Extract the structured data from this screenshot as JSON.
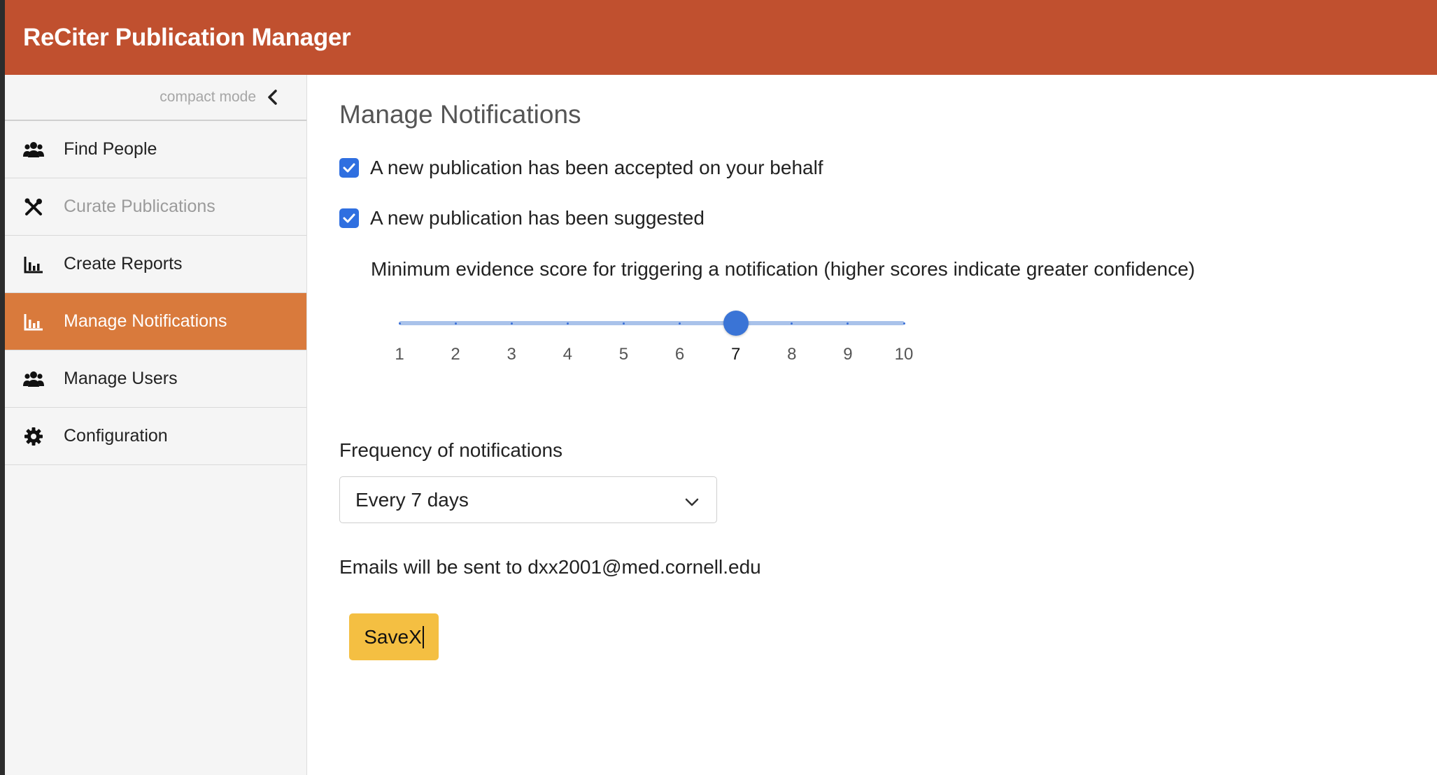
{
  "header": {
    "title": "ReCiter Publication Manager"
  },
  "sidebar": {
    "compact_mode_label": "compact mode",
    "items": [
      {
        "label": "Find People",
        "icon": "users-icon",
        "state": "normal"
      },
      {
        "label": "Curate Publications",
        "icon": "tools-icon",
        "state": "disabled"
      },
      {
        "label": "Create Reports",
        "icon": "bar-chart-icon",
        "state": "normal"
      },
      {
        "label": "Manage Notifications",
        "icon": "bar-chart-icon",
        "state": "active"
      },
      {
        "label": "Manage Users",
        "icon": "users-icon",
        "state": "normal"
      },
      {
        "label": "Configuration",
        "icon": "gear-icon",
        "state": "normal"
      }
    ]
  },
  "main": {
    "title": "Manage Notifications",
    "checkboxes": [
      {
        "label": "A new publication has been accepted on your behalf",
        "checked": true
      },
      {
        "label": "A new publication has been suggested",
        "checked": true
      }
    ],
    "slider": {
      "label": "Minimum evidence score for triggering a notification (higher scores indicate greater confidence)",
      "ticks": [
        "1",
        "2",
        "3",
        "4",
        "5",
        "6",
        "7",
        "8",
        "9",
        "10"
      ],
      "value": 7,
      "min": 1,
      "max": 10
    },
    "frequency": {
      "label": "Frequency of notifications",
      "selected": "Every 7 days"
    },
    "email_note": "Emails will be sent to dxx2001@med.cornell.edu",
    "save_label": "SaveX"
  },
  "colors": {
    "header": "#c0502f",
    "active_nav": "#d97a3c",
    "checkbox": "#2f6fe0",
    "slider_thumb": "#3a74d6",
    "save_button": "#f4bf42"
  }
}
